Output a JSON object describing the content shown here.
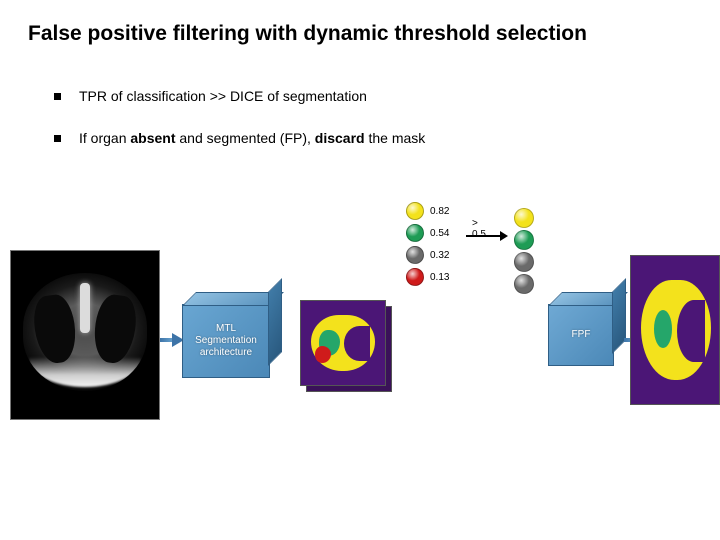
{
  "title": "False positive filtering with dynamic threshold selection",
  "bullets": {
    "b1": "TPR of classification >> DICE of segmentation",
    "b2_pre": "If organ ",
    "b2_absent": "absent",
    "b2_mid": " and segmented (FP), ",
    "b2_discard": "discard",
    "b2_post": " the mask"
  },
  "blocks": {
    "mtl": "MTL Segmentation architecture",
    "fpf": "FPF"
  },
  "scores": [
    {
      "color": "#f3e21c",
      "value": "0.82"
    },
    {
      "color": "#1e9c55",
      "value": "0.54"
    },
    {
      "color": "#6a6a6a",
      "value": "0.32"
    },
    {
      "color": "#cf1b1b",
      "value": "0.13"
    }
  ],
  "threshold_label": "> 0.5",
  "post_threshold_dots": [
    "#f3e21c",
    "#1e9c55",
    "#6a6a6a",
    "#6a6a6a"
  ]
}
